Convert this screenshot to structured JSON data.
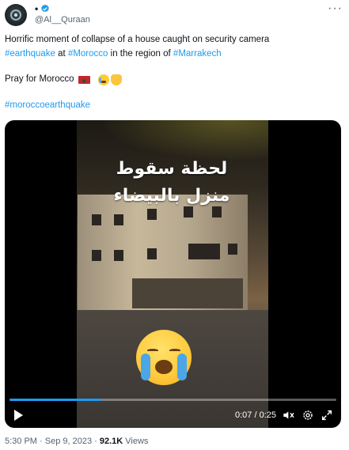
{
  "author": {
    "display_name": "•",
    "handle": "@Al__Quraan",
    "more_label": "···"
  },
  "tweet": {
    "line1": "Horrific moment of collapse of a house caught on security camera",
    "line2_hashtag1": "#earthquake",
    "line2_text1": " at ",
    "line2_hashtag2": "#Morocco",
    "line2_text2": " in the region of ",
    "line2_hashtag3": "#Marrakech",
    "line3_text": "Pray for Morocco",
    "hashtag_line": "#moroccoearthquake"
  },
  "video": {
    "overlay_line1": "لحظة سقوط",
    "overlay_line2": "منزل بالبيضاء",
    "current_time": "0:07",
    "separator": " / ",
    "duration": "0:25",
    "progress": 0.28
  },
  "footer": {
    "time": "5:30 PM",
    "dot": " · ",
    "date": "Sep 9, 2023",
    "dot2": " · ",
    "views_count": "92.1K",
    "views_label": " Views"
  },
  "colors": {
    "accent": "#1d9bf0",
    "text": "#0f1419",
    "secondary": "#536471"
  }
}
